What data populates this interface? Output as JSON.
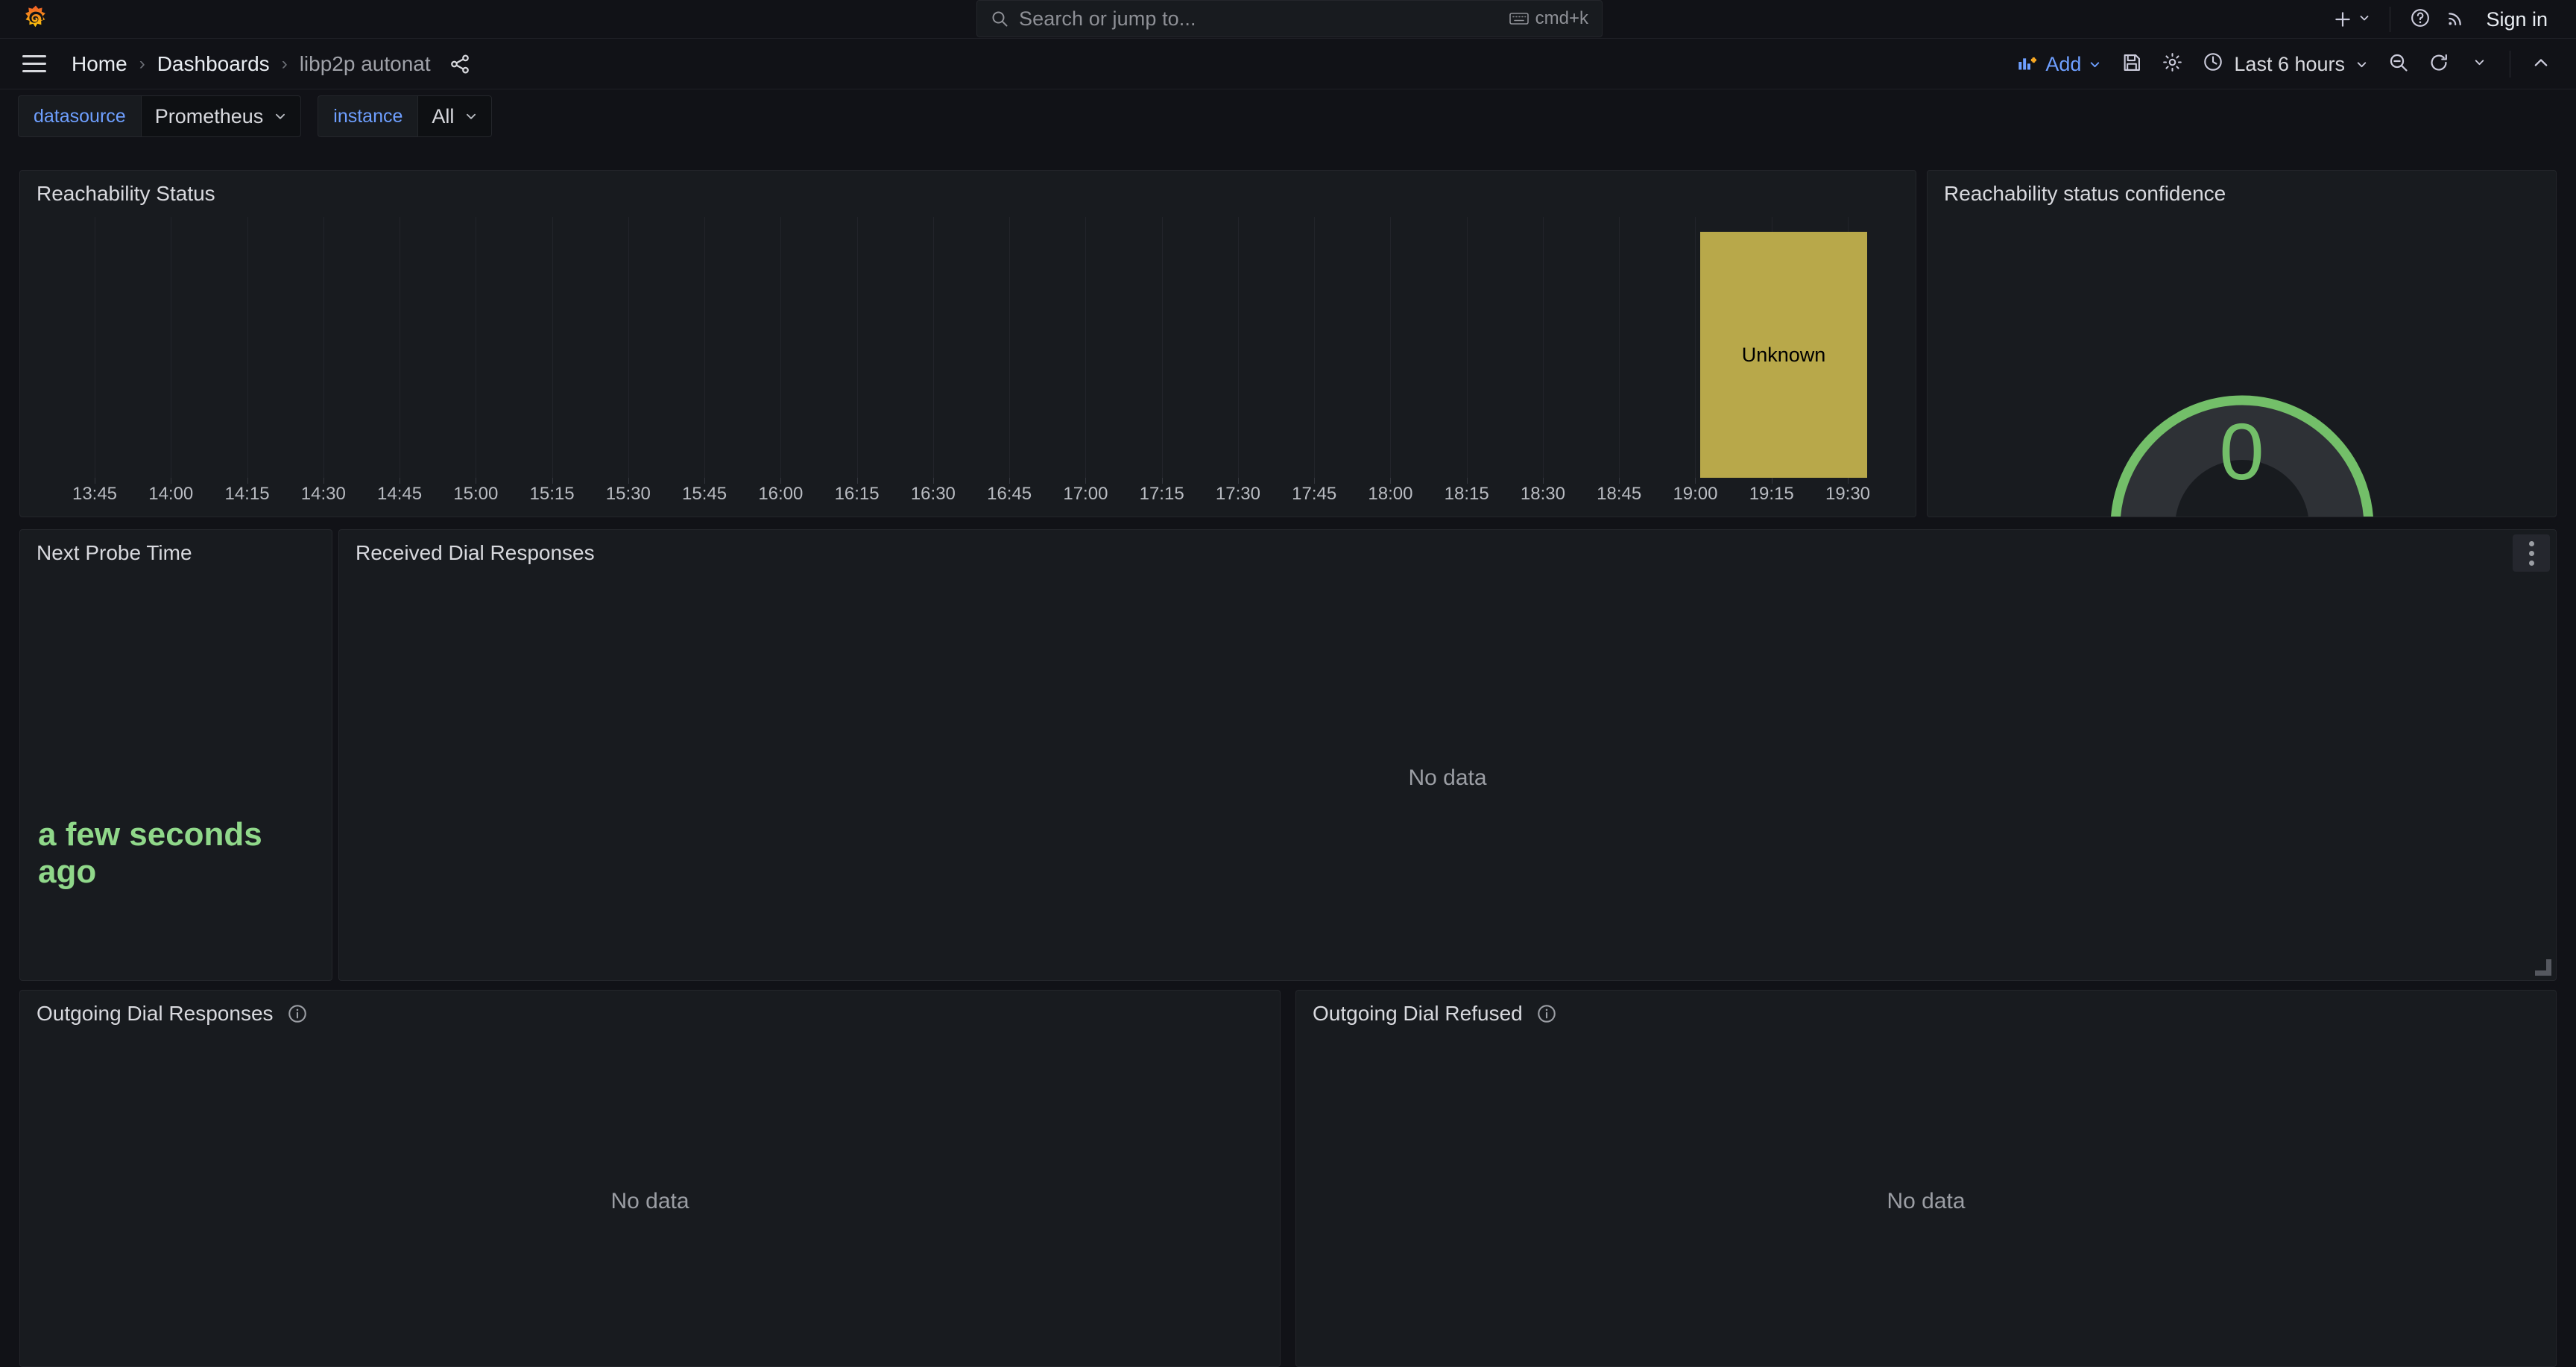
{
  "topbar": {
    "logo_icon": "grafana-logo-icon",
    "search": {
      "icon": "search-icon",
      "placeholder": "Search or jump to...",
      "value": "",
      "shortcut_icon": "keyboard-icon",
      "shortcut": "cmd+k"
    },
    "actions": {
      "add_icon": "plus-icon",
      "add_chevron_icon": "chevron-down-icon",
      "help_icon": "help-circle-icon",
      "news_icon": "rss-icon",
      "signin_label": "Sign in"
    }
  },
  "navrow": {
    "menu_icon": "hamburger-menu-icon",
    "breadcrumbs": [
      {
        "label": "Home",
        "current": false
      },
      {
        "label": "Dashboards",
        "current": false
      },
      {
        "label": "libp2p autonat",
        "current": true
      }
    ],
    "separator": "›",
    "share_icon": "share-icon",
    "toolbar": {
      "add_label": "Add",
      "add_panel_icon": "add-panel-icon",
      "add_chevron_icon": "chevron-down-icon",
      "save_icon": "save-disk-icon",
      "settings_icon": "gear-icon",
      "time_icon": "clock-icon",
      "time_range": "Last 6 hours",
      "time_chevron_icon": "chevron-down-icon",
      "zoom_out_icon": "zoom-out-icon",
      "refresh_icon": "refresh-icon",
      "refresh_chevron_icon": "chevron-down-icon",
      "collapse_icon": "chevron-up-icon"
    }
  },
  "variables": [
    {
      "label": "datasource",
      "value": "Prometheus",
      "chevron_icon": "chevron-down-icon"
    },
    {
      "label": "instance",
      "value": "All",
      "chevron_icon": "chevron-down-icon"
    }
  ],
  "panels": {
    "reachability_status": {
      "title": "Reachability Status",
      "chart_data": {
        "type": "state-timeline",
        "title": "Reachability Status",
        "xlabel": "",
        "ylabel": "",
        "grid": true,
        "legend": "none",
        "x_ticks": [
          "13:45",
          "14:00",
          "14:15",
          "14:30",
          "14:45",
          "15:00",
          "15:15",
          "15:30",
          "15:45",
          "16:00",
          "16:15",
          "16:30",
          "16:45",
          "17:00",
          "17:15",
          "17:30",
          "17:45",
          "18:00",
          "18:15",
          "18:30",
          "18:45",
          "19:00",
          "19:15",
          "19:30"
        ],
        "x_tick_clipped_last": true,
        "states": [
          {
            "label": "Unknown",
            "color": "#b8a84a",
            "start": "18:57",
            "end": "19:26"
          }
        ]
      }
    },
    "reachability_confidence": {
      "title": "Reachability status confidence",
      "chart_data": {
        "type": "gauge",
        "title": "Reachability status confidence",
        "value": 0,
        "display_value": "0",
        "min": 0,
        "max": 3,
        "color": "#73bf69",
        "track_color": "#2e3136"
      }
    },
    "next_probe_time": {
      "title": "Next Probe Time",
      "value": "a few seconds ago",
      "value_color": "#90d88a"
    },
    "received_dial_responses": {
      "title": "Received Dial Responses",
      "nodata": "No data",
      "menu_icon": "kebab-menu-icon",
      "resize_icon": "resize-handle-icon"
    },
    "outgoing_dial_responses": {
      "title": "Outgoing Dial Responses",
      "info_icon": "info-circle-icon",
      "nodata": "No data"
    },
    "outgoing_dial_refused": {
      "title": "Outgoing Dial Refused",
      "info_icon": "info-circle-icon",
      "nodata": "No data"
    }
  },
  "colors": {
    "background": "#111217",
    "panel_background": "#181b1f",
    "border": "#24262b",
    "accent_blue": "#6e9fff",
    "green": "#73bf69",
    "yellow": "#b8a84a",
    "text_primary": "#d8d9de",
    "text_secondary": "#9b9ea4"
  }
}
